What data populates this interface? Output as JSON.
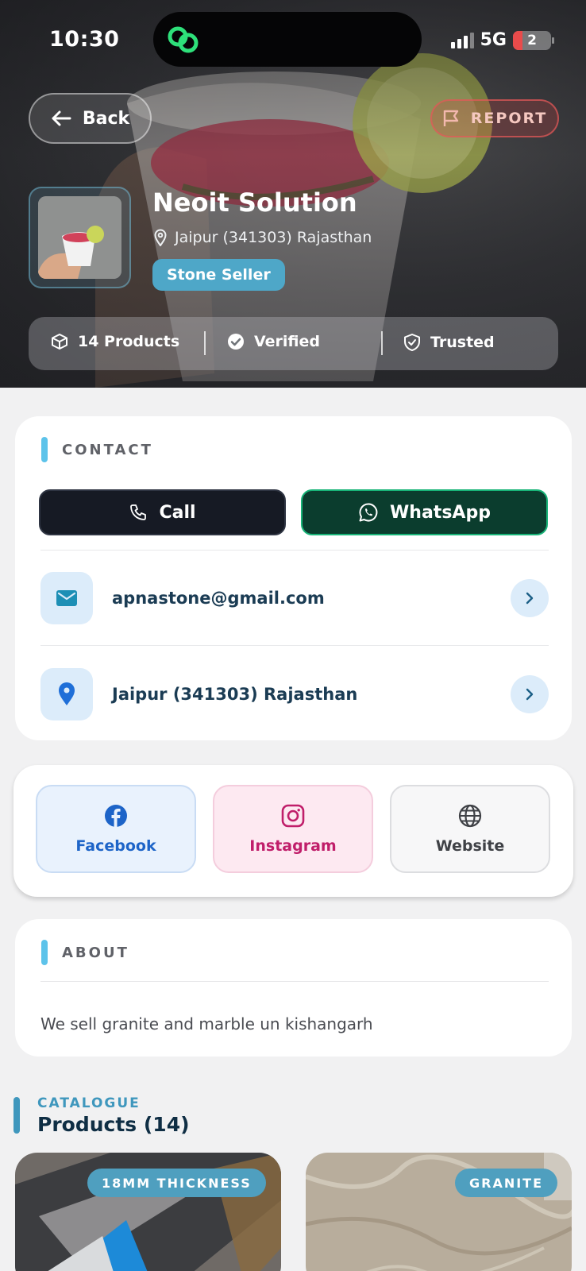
{
  "status_bar": {
    "time": "10:30",
    "network": "5G",
    "battery": "2"
  },
  "header": {
    "back_label": "Back",
    "report_label": "REPORT",
    "business_name": "Neoit Solution",
    "location": "Jaipur (341303) Rajasthan",
    "badge": "Stone Seller",
    "stats": {
      "products": "14 Products",
      "verified": "Verified",
      "trusted": "Trusted"
    }
  },
  "contact": {
    "title": "CONTACT",
    "call_label": "Call",
    "whatsapp_label": "WhatsApp",
    "email": "apnastone@gmail.com",
    "address": "Jaipur (341303) Rajasthan"
  },
  "social": {
    "facebook": "Facebook",
    "instagram": "Instagram",
    "website": "Website"
  },
  "about": {
    "title": "ABOUT",
    "text": "We sell granite and marble un kishangarh"
  },
  "catalogue": {
    "eyebrow": "CATALOGUE",
    "title": "Products (14)",
    "products": [
      {
        "tag": "18MM THICKNESS"
      },
      {
        "tag": "GRANITE"
      }
    ]
  },
  "colors": {
    "accent": "#5dc3ea",
    "whatsapp": "#18b478",
    "facebook": "#1d64c8",
    "instagram": "#c01e6a",
    "badge": "#4ea7c8"
  },
  "icons": [
    "arrow-left-icon",
    "flag-icon",
    "map-pin-icon",
    "box-icon",
    "check-circle-icon",
    "shield-check-icon",
    "phone-icon",
    "whatsapp-icon",
    "mail-icon",
    "chevron-right-icon",
    "facebook-icon",
    "instagram-icon",
    "globe-icon"
  ]
}
